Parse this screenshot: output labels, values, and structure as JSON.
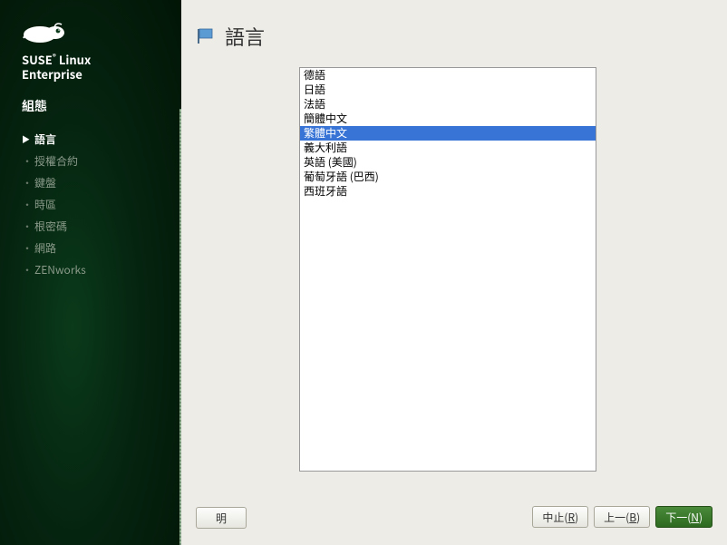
{
  "brand": {
    "line1": "SUSE",
    "line1b": "Linux",
    "line2": "Enterprise",
    "reg": "®"
  },
  "sidebar": {
    "section": "組態",
    "items": [
      {
        "label": "語言",
        "active": true
      },
      {
        "label": "授權合約",
        "active": false
      },
      {
        "label": "鍵盤",
        "active": false
      },
      {
        "label": "時區",
        "active": false
      },
      {
        "label": "根密碼",
        "active": false
      },
      {
        "label": "網路",
        "active": false
      },
      {
        "label": "ZENworks",
        "active": false
      }
    ]
  },
  "header": {
    "title": "語言"
  },
  "languages": {
    "selected_index": 4,
    "options": [
      "德語",
      "日語",
      "法語",
      "簡體中文",
      "繁體中文",
      "義大利語",
      "英語 (美國)",
      "葡萄牙語 (巴西)",
      "西班牙語"
    ]
  },
  "footer": {
    "help": "明",
    "abort": "中止(R)",
    "back": "上一(B)",
    "next": "下一(N)"
  }
}
